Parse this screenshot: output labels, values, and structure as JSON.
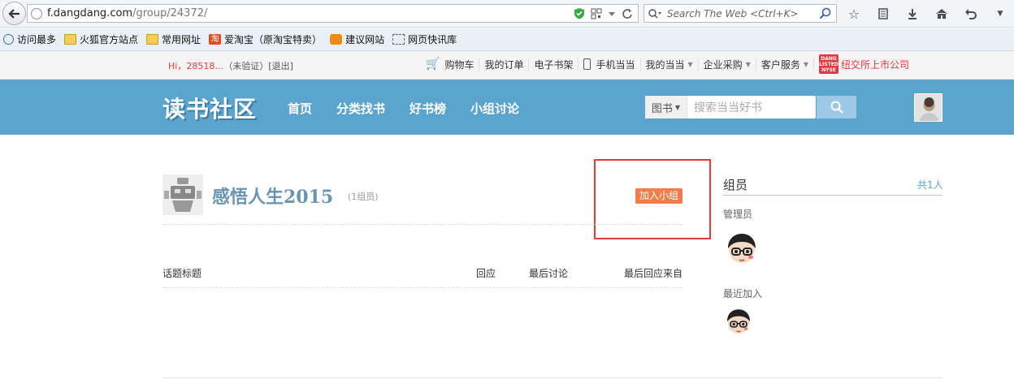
{
  "browser": {
    "url_host": "f.dangdang.com",
    "url_path": "/group/24372/",
    "search_placeholder": "Search The Web <Ctrl+K>",
    "bookmarks": [
      {
        "label": "访问最多",
        "icon": "gear-icon"
      },
      {
        "label": "火狐官方站点",
        "icon": "folder-icon"
      },
      {
        "label": "常用网址",
        "icon": "folder-icon"
      },
      {
        "label": "爱淘宝（原淘宝特卖）",
        "icon": "taobao-icon"
      },
      {
        "label": "建议网站",
        "icon": "bulb-icon"
      },
      {
        "label": "网页快讯库",
        "icon": "feed-icon"
      }
    ]
  },
  "topbar": {
    "greeting_prefix": "Hi，",
    "user": "28518…",
    "status": "（未验证）",
    "logout": "[退出]",
    "links": {
      "cart": "购物车",
      "orders": "我的订单",
      "ebook": "电子书架",
      "mobile": "手机当当",
      "my": "我的当当",
      "enterprise": "企业采购",
      "service": "客户服务",
      "listed": "纽交所上市公司",
      "nyse_badge": "DANG LISTED NYSE"
    }
  },
  "header": {
    "logo": "读书社区",
    "nav": [
      "首页",
      "分类找书",
      "好书榜",
      "小组讨论"
    ],
    "search_category": "图书",
    "search_placeholder": "搜索当当好书"
  },
  "group": {
    "name": "感悟人生2015",
    "member_count": "(1组员)",
    "join_label": "加入小组"
  },
  "topics_table": {
    "columns": [
      "话题标题",
      "回应",
      "最后讨论",
      "最后回应来自"
    ]
  },
  "sidebar": {
    "title": "组员",
    "total": "共1人",
    "admin_label": "管理员",
    "recent_label": "最近加入"
  },
  "colors": {
    "header_bg": "#5aa4cd",
    "join_button": "#f17d4a",
    "group_title": "#6a95b0",
    "highlight_box": "#e23b3b"
  }
}
